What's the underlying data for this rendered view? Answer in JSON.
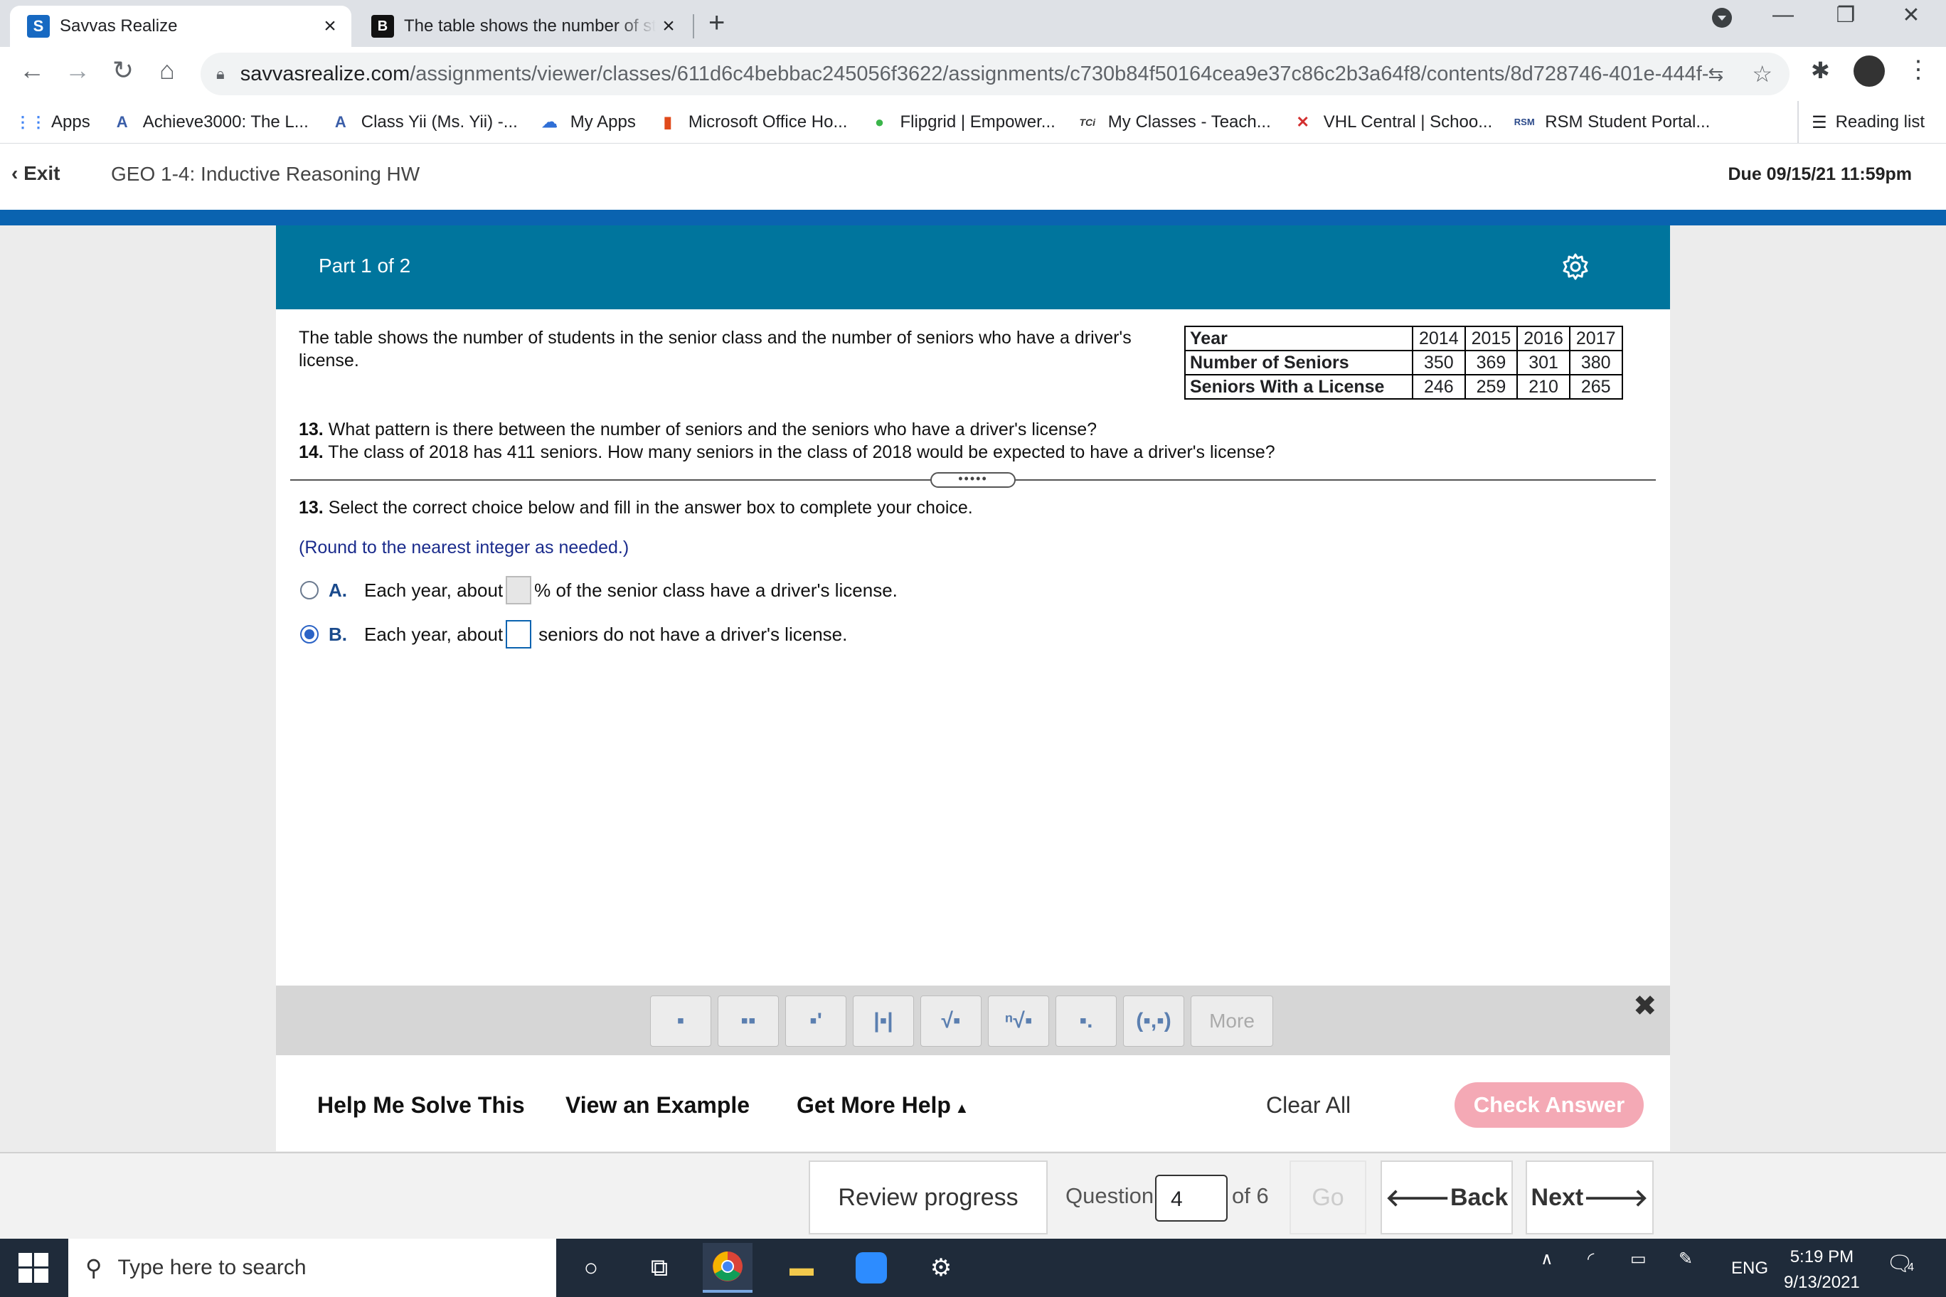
{
  "browser": {
    "tabs": [
      {
        "title": "Savvas Realize",
        "icon": "savvas-icon"
      },
      {
        "title": "The table shows the number of st",
        "icon": "bartleby-icon"
      }
    ],
    "url_host": "savvasrealize.com",
    "url_path": "/assignments/viewer/classes/611d6c4bebbac245056f3622/assignments/c730b84f50164cea9e37c86c2b3a64f8/contents/8d728746-401e-444f-a1...",
    "bookmarks": [
      {
        "label": "Apps"
      },
      {
        "label": "Achieve3000: The L..."
      },
      {
        "label": "Class Yii (Ms. Yii) -..."
      },
      {
        "label": "My Apps"
      },
      {
        "label": "Microsoft Office Ho..."
      },
      {
        "label": "Flipgrid | Empower..."
      },
      {
        "label": "My Classes - Teach..."
      },
      {
        "label": "VHL Central | Schoo..."
      },
      {
        "label": "RSM Student Portal..."
      }
    ],
    "reading_list": "Reading list"
  },
  "header": {
    "exit": "Exit",
    "title": "GEO 1-4: Inductive Reasoning HW",
    "due": "Due 09/15/21 11:59pm"
  },
  "part": {
    "label": "Part 1 of 2"
  },
  "problem": {
    "intro": "The table shows the number of students in the senior class and the number of seniors who have a driver's license.",
    "q13_num": "13.",
    "q13": "What pattern is there between the number of seniors and the seniors who have a driver's license?",
    "q14_num": "14.",
    "q14": "The class of 2018 has 411 seniors. How many seniors in the class of 2018 would be expected to have a driver's license?"
  },
  "table": {
    "row_labels": [
      "Year",
      "Number of Seniors",
      "Seniors With a License"
    ],
    "years": [
      "2014",
      "2015",
      "2016",
      "2017"
    ],
    "seniors": [
      "350",
      "369",
      "301",
      "380"
    ],
    "licensed": [
      "246",
      "259",
      "210",
      "265"
    ]
  },
  "answer": {
    "num": "13.",
    "instruction": "Select the correct choice below and fill in the answer box to complete your choice.",
    "round_note": "(Round to the nearest integer as needed.)",
    "choice_a_letter": "A.",
    "choice_a_pre": "Each year, about",
    "choice_a_post": "% of the senior class have a driver's license.",
    "choice_b_letter": "B.",
    "choice_b_pre": "Each year, about",
    "choice_b_post": "seniors do not have a driver's license.",
    "selected": "B"
  },
  "toolbar": {
    "more": "More"
  },
  "help": {
    "solve": "Help Me Solve This",
    "example": "View an Example",
    "more_help": "Get More Help",
    "clear_all": "Clear All",
    "check": "Check Answer"
  },
  "nav": {
    "review": "Review progress",
    "question_label": "Question",
    "question_value": "4",
    "of": "of 6",
    "go": "Go",
    "back": "Back",
    "next": "Next"
  },
  "taskbar": {
    "search_placeholder": "Type here to search",
    "lang": "ENG",
    "time": "5:19 PM",
    "date": "9/13/2021",
    "notifications": "4"
  },
  "colors": {
    "accent": "#00759d",
    "brand_bar": "#0a63b0",
    "check_answer": "#f4a9b5"
  }
}
